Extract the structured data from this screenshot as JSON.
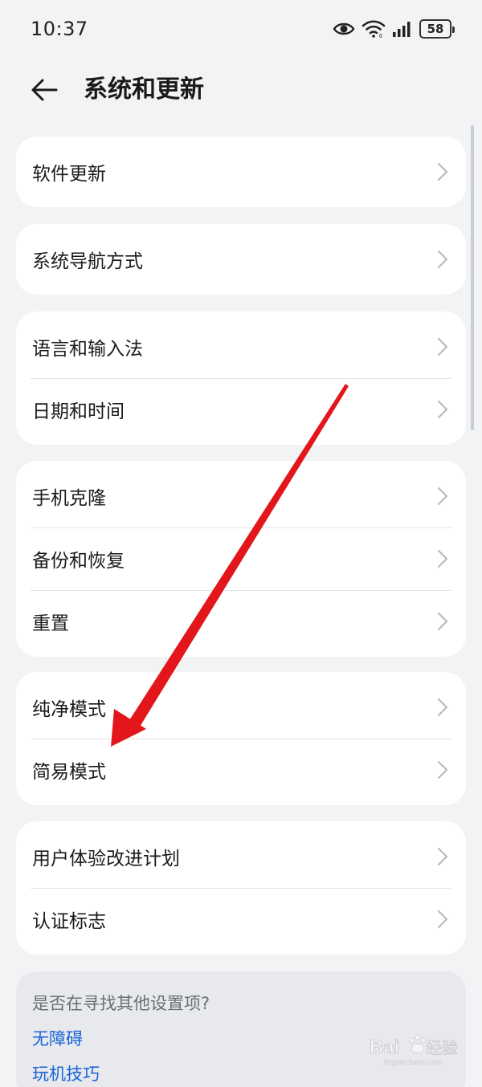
{
  "status": {
    "time": "10:37",
    "battery": "58",
    "icons": [
      "eye-icon",
      "wifi-icon",
      "signal-icon",
      "battery-icon"
    ]
  },
  "header": {
    "title": "系统和更新",
    "back_icon": "back-arrow-icon"
  },
  "groups": [
    {
      "items": [
        {
          "label": "软件更新"
        }
      ]
    },
    {
      "items": [
        {
          "label": "系统导航方式"
        }
      ]
    },
    {
      "items": [
        {
          "label": "语言和输入法"
        },
        {
          "label": "日期和时间"
        }
      ]
    },
    {
      "items": [
        {
          "label": "手机克隆"
        },
        {
          "label": "备份和恢复"
        },
        {
          "label": "重置"
        }
      ]
    },
    {
      "items": [
        {
          "label": "纯净模式"
        },
        {
          "label": "简易模式"
        }
      ]
    },
    {
      "items": [
        {
          "label": "用户体验改进计划"
        },
        {
          "label": "认证标志"
        }
      ]
    }
  ],
  "suggestions": {
    "title": "是否在寻找其他设置项?",
    "links": [
      {
        "label": "无障碍"
      },
      {
        "label": "玩机技巧"
      }
    ]
  },
  "watermark": {
    "text": "Baidu经验",
    "sub": "jingyan.baidu.com"
  },
  "colors": {
    "background": "#f1f3f5",
    "card": "#ffffff",
    "link": "#1a63d8",
    "annotation_arrow": "#e3161b"
  }
}
